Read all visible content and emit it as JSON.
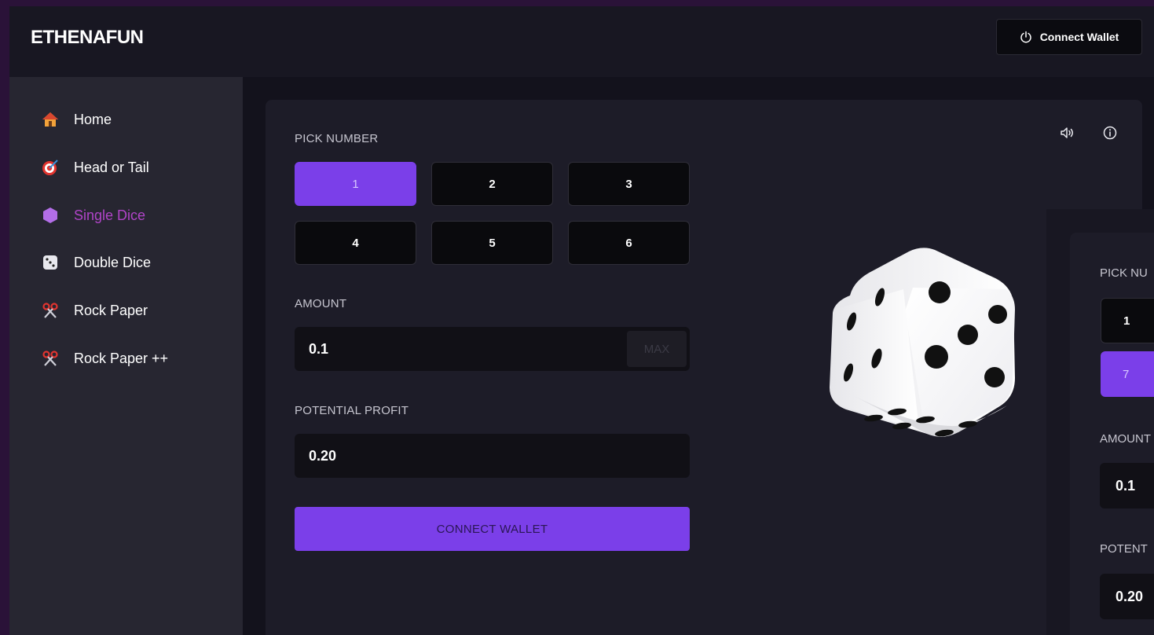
{
  "brand": {
    "logo": "ETHENAFUN"
  },
  "header": {
    "connect_label": "Connect Wallet",
    "connect_icon": "power-icon"
  },
  "sidebar": {
    "items": [
      {
        "label": "Home",
        "icon": "home-icon",
        "active": false
      },
      {
        "label": "Head or Tail",
        "icon": "target-icon",
        "active": false
      },
      {
        "label": "Single Dice",
        "icon": "hexagon-icon",
        "active": true
      },
      {
        "label": "Double Dice",
        "icon": "dice-icon",
        "active": false
      },
      {
        "label": "Rock Paper",
        "icon": "scissors-icon",
        "active": false
      },
      {
        "label": "Rock Paper ++",
        "icon": "scissors-icon",
        "active": false
      }
    ]
  },
  "game": {
    "pick_label": "PICK NUMBER",
    "numbers": [
      "1",
      "2",
      "3",
      "4",
      "5",
      "6"
    ],
    "selected": "1",
    "amount_label": "AMOUNT",
    "amount_value": "0.1",
    "max_label": "MAX",
    "profit_label": "POTENTIAL PROFIT",
    "profit_value": "0.20",
    "connect_label": "CONNECT WALLET",
    "toolbar_icons": [
      "sound-icon",
      "info-icon"
    ]
  },
  "second_card": {
    "pick_label": "PICK NU",
    "btn_a": "1",
    "btn_b": "7",
    "amount_label": "AMOUNT",
    "amount_value": "0.1",
    "profit_label": "POTENT",
    "profit_value": "0.20"
  },
  "colors": {
    "accent": "#7b3fe9",
    "active_nav": "#b044c8",
    "background": "#13121c",
    "sidebar": "#272631",
    "card": "#1d1c28"
  }
}
